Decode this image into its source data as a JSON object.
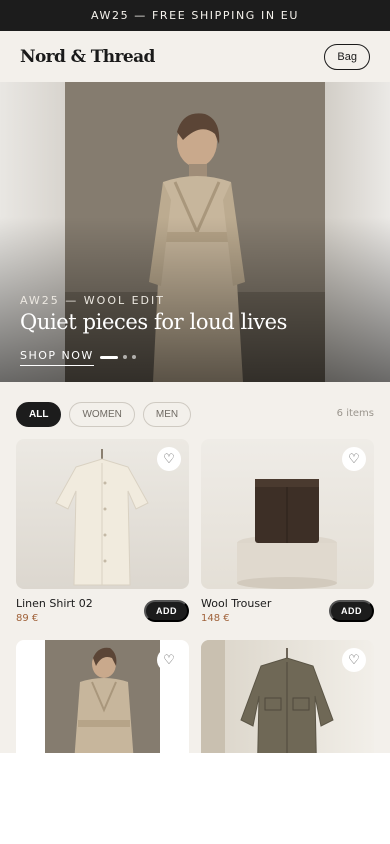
{
  "announcement": "AW25 — FREE SHIPPING IN EU",
  "header": {
    "brand": "Nord & Thread",
    "bag_label": "Bag"
  },
  "hero": {
    "kicker": "AW25 — WOOL EDIT",
    "title": "Quiet pieces for loud lives",
    "cta": "SHOP NOW",
    "slides": 3,
    "active_slide": 1
  },
  "filters": {
    "chips": [
      {
        "label": "ALL",
        "active": true
      },
      {
        "label": "WOMEN",
        "active": false
      },
      {
        "label": "MEN",
        "active": false
      }
    ],
    "count": "6 items"
  },
  "products": [
    {
      "name": "Linen Shirt 02",
      "price": "89 €",
      "add_label": "ADD",
      "fav_icon": "heart-icon"
    },
    {
      "name": "Wool Trouser",
      "price": "148 €",
      "add_label": "ADD",
      "fav_icon": "heart-icon"
    },
    {
      "name": "",
      "price": "",
      "add_label": "",
      "fav_icon": "heart-icon"
    },
    {
      "name": "",
      "price": "",
      "add_label": "",
      "fav_icon": "heart-icon"
    }
  ],
  "colors": {
    "dark": "#1c1c1c",
    "background": "#f3f0eb",
    "price": "#a0623a"
  }
}
